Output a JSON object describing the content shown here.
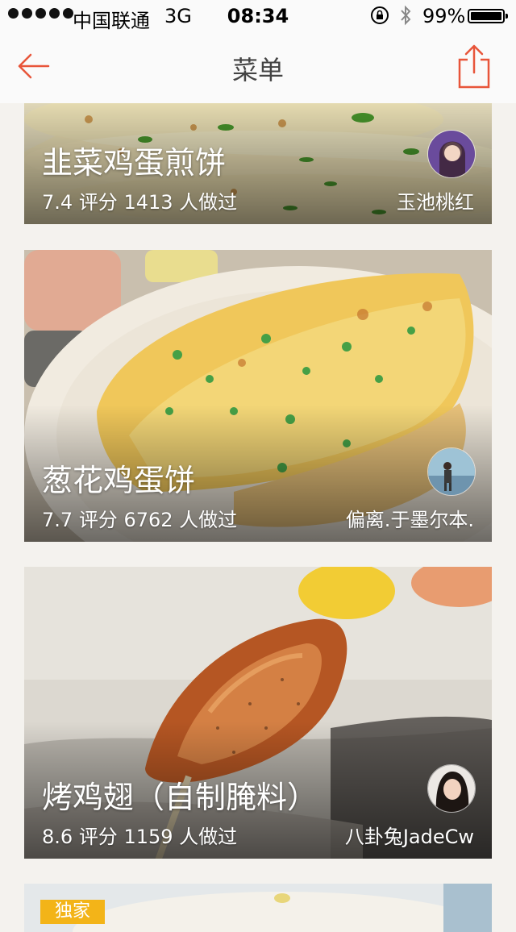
{
  "status_bar": {
    "carrier": "中国联通",
    "network": "3G",
    "time": "08:34",
    "battery_percent": "99%"
  },
  "nav": {
    "title": "菜单",
    "accent_color": "#e8553a"
  },
  "recipes": [
    {
      "name": "韭菜鸡蛋煎饼",
      "rating": "7.4",
      "rating_label": "评分",
      "count": "1413",
      "count_label": "人做过",
      "author": "玉池桃红"
    },
    {
      "name": "葱花鸡蛋饼",
      "rating": "7.7",
      "rating_label": "评分",
      "count": "6762",
      "count_label": "人做过",
      "author": "偏离.于墨尔本."
    },
    {
      "name": "烤鸡翅（自制腌料）",
      "rating": "8.6",
      "rating_label": "评分",
      "count": "1159",
      "count_label": "人做过",
      "author": "八卦兔JadeCw"
    },
    {
      "badge": "独家"
    }
  ]
}
